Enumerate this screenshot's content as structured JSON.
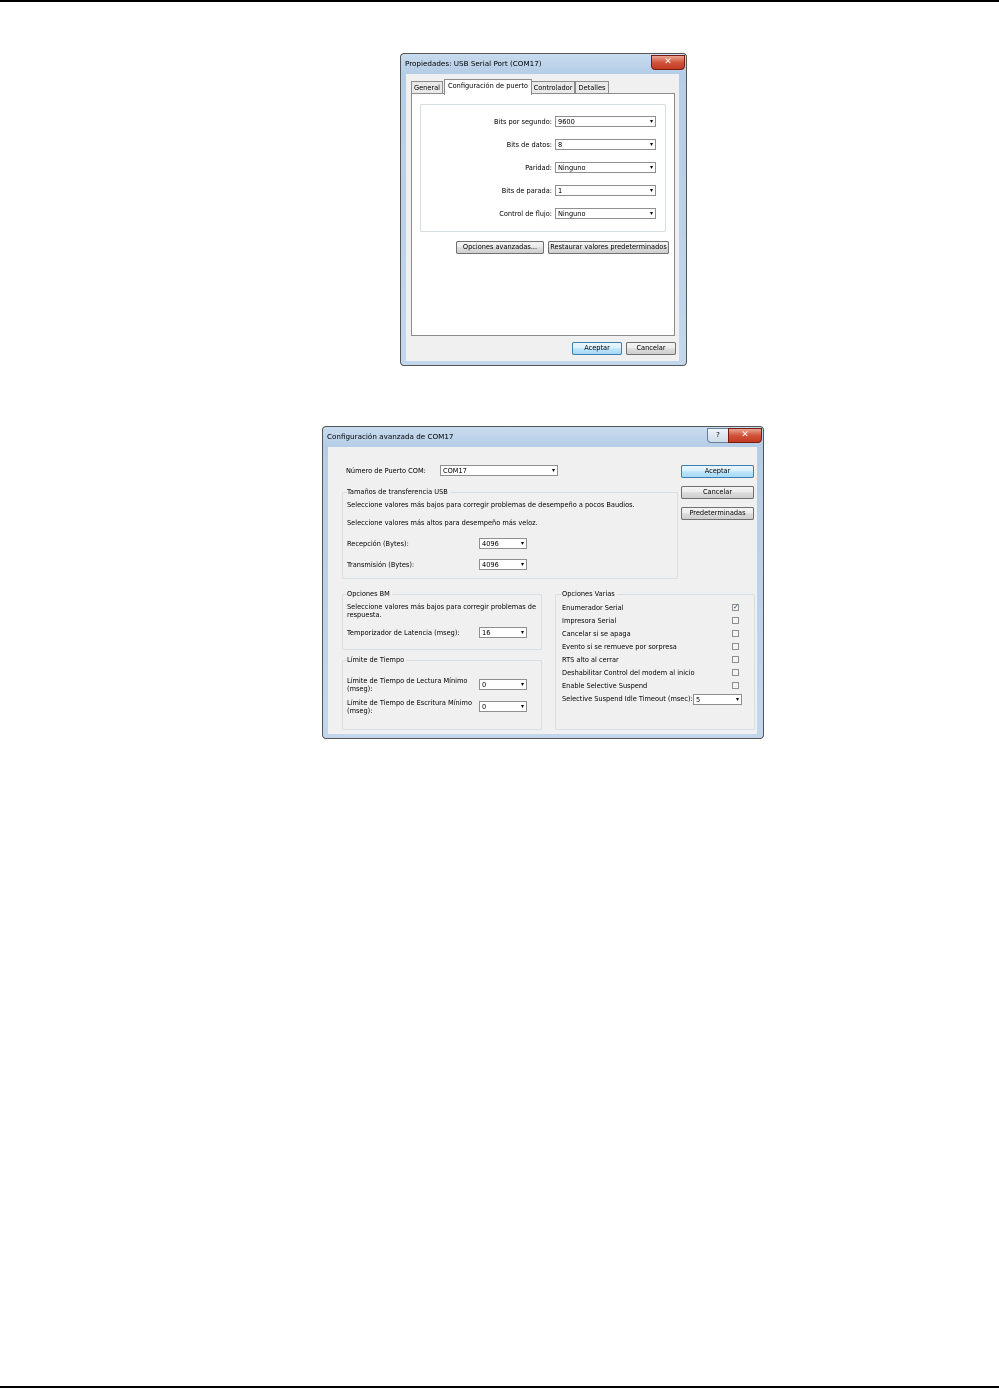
{
  "dialog1": {
    "title": "Propiedades: USB Serial Port (COM17)",
    "tabs": [
      "General",
      "Configuración de puerto",
      "Controlador",
      "Detalles"
    ],
    "fields": [
      {
        "label": "Bits por segundo:",
        "value": "9600"
      },
      {
        "label": "Bits de datos:",
        "value": "8"
      },
      {
        "label": "Paridad:",
        "value": "Ninguno"
      },
      {
        "label": "Bits de parada:",
        "value": "1"
      },
      {
        "label": "Control de flujo:",
        "value": "Ninguno"
      }
    ],
    "advanced_button": "Opciones avanzadas...",
    "restore_button": "Restaurar valores predeterminados",
    "ok_button": "Aceptar",
    "cancel_button": "Cancelar",
    "close_glyph": "✕"
  },
  "dialog2": {
    "title": "Configuración avanzada de COM17",
    "help_glyph": "?",
    "close_glyph": "✕",
    "com_port_label": "Número de Puerto COM:",
    "com_port_value": "COM17",
    "ok_button": "Aceptar",
    "cancel_button": "Cancelar",
    "defaults_button": "Predeterminadas",
    "usb": {
      "title": "Tamaños de transferencia USB",
      "desc1": "Seleccione valores más bajos para corregir problemas de desempeño a pocos Baudios.",
      "desc2": "Seleccione valores más altos para desempeño más veloz.",
      "rx_label": "Recepción (Bytes):",
      "rx_value": "4096",
      "tx_label": "Transmisión (Bytes):",
      "tx_value": "4096"
    },
    "bm": {
      "title": "Opciones BM",
      "desc": "Seleccione valores más bajos para corregir problemas de respuesta.",
      "latency_label": "Temporizador de Latencia (mseg):",
      "latency_value": "16"
    },
    "timeouts": {
      "title": "Límite de Tiempo",
      "read_label": "Límite de Tiempo de Lectura Mínimo (mseg):",
      "read_value": "0",
      "write_label": "Límite de Tiempo de Escritura Mínimo (mseg):",
      "write_value": "0"
    },
    "misc": {
      "title": "Opciones Varias",
      "options": [
        {
          "label": "Enumerador Serial",
          "checked": true
        },
        {
          "label": "Impresora Serial",
          "checked": false
        },
        {
          "label": "Cancelar si se apaga",
          "checked": false
        },
        {
          "label": "Evento si se remueve por sorpresa",
          "checked": false
        },
        {
          "label": "RTS alto al cerrar",
          "checked": false
        },
        {
          "label": "Deshabilitar Control del modem al inicio",
          "checked": false
        },
        {
          "label": "Enable Selective Suspend",
          "checked": false
        }
      ],
      "idle_label": "Selective Suspend Idle Timeout (msec):",
      "idle_value": "5"
    }
  },
  "icons": {
    "dropdown": "dropdown-arrow-icon",
    "check": "✓",
    "arrow": "▾"
  }
}
